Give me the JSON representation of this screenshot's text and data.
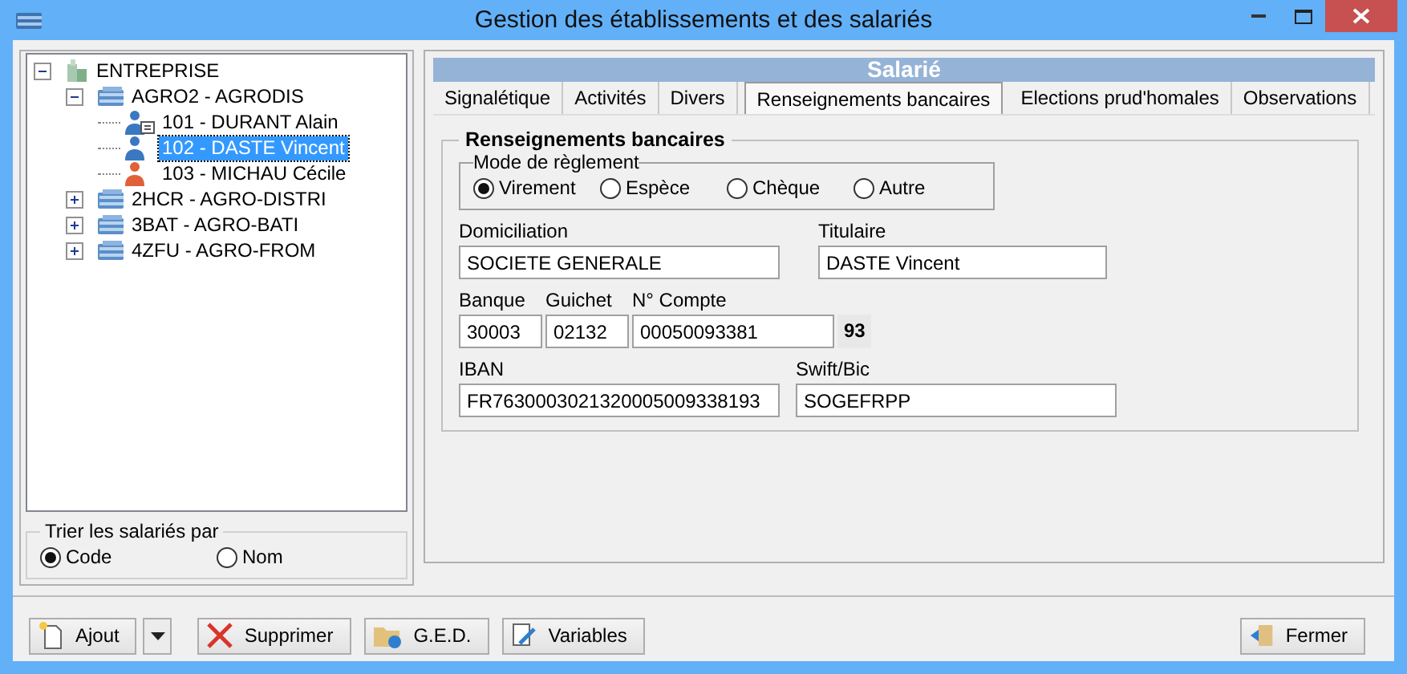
{
  "window": {
    "title": "Gestion des établissements et des salariés"
  },
  "tree": [
    {
      "label": "ENTREPRISE",
      "kind": "enterprise",
      "expanded": true,
      "selected": false,
      "children": [
        {
          "label": "AGRO2 - AGRODIS",
          "kind": "establishment",
          "expanded": true,
          "selected": false,
          "children": [
            {
              "label": "101 - DURANT Alain",
              "kind": "man-card",
              "selected": false
            },
            {
              "label": "102 - DASTE Vincent",
              "kind": "man",
              "selected": true
            },
            {
              "label": "103 - MICHAU  Cécile",
              "kind": "woman",
              "selected": false
            }
          ]
        },
        {
          "label": "2HCR - AGRO-DISTRI",
          "kind": "establishment",
          "expanded": false,
          "selected": false
        },
        {
          "label": "3BAT - AGRO-BATI",
          "kind": "establishment",
          "expanded": false,
          "selected": false
        },
        {
          "label": "4ZFU - AGRO-FROM",
          "kind": "establishment",
          "expanded": false,
          "selected": false
        }
      ]
    }
  ],
  "sort": {
    "title": "Trier les salariés par",
    "options": [
      {
        "label": "Code",
        "selected": true
      },
      {
        "label": "Nom",
        "selected": false
      }
    ]
  },
  "panel": {
    "title": "Salarié",
    "tabs": [
      {
        "label": "Signalétique",
        "selected": false
      },
      {
        "label": "Activités",
        "selected": false
      },
      {
        "label": "Divers",
        "selected": false
      },
      {
        "label": "Renseignements bancaires",
        "selected": true
      },
      {
        "label": "Elections prud'homales",
        "selected": false
      },
      {
        "label": "Observations",
        "selected": false
      }
    ],
    "group_title": "Renseignements bancaires",
    "payment": {
      "title": "Mode de règlement",
      "options": [
        {
          "label": "Virement",
          "selected": true
        },
        {
          "label": "Espèce",
          "selected": false
        },
        {
          "label": "Chèque",
          "selected": false
        },
        {
          "label": "Autre",
          "selected": false
        }
      ]
    },
    "domiciliation": {
      "label": "Domiciliation",
      "value": "SOCIETE GENERALE"
    },
    "titulaire": {
      "label": "Titulaire",
      "value": "DASTE Vincent"
    },
    "banque": {
      "label": "Banque",
      "value": "30003"
    },
    "guichet": {
      "label": "Guichet",
      "value": "02132"
    },
    "compte": {
      "label": "N° Compte",
      "value": "00050093381"
    },
    "cle": "93",
    "iban": {
      "label": "IBAN",
      "value": "FR7630003021320005009338193"
    },
    "swift": {
      "label": "Swift/Bic",
      "value": "SOGEFRPP"
    }
  },
  "buttons": [
    {
      "label": "Ajout",
      "kind": "add"
    },
    {
      "label": "Supprimer",
      "kind": "delete"
    },
    {
      "label": "G.E.D.",
      "kind": "ged"
    },
    {
      "label": "Variables",
      "kind": "variables"
    }
  ],
  "close_button": {
    "label": "Fermer"
  }
}
